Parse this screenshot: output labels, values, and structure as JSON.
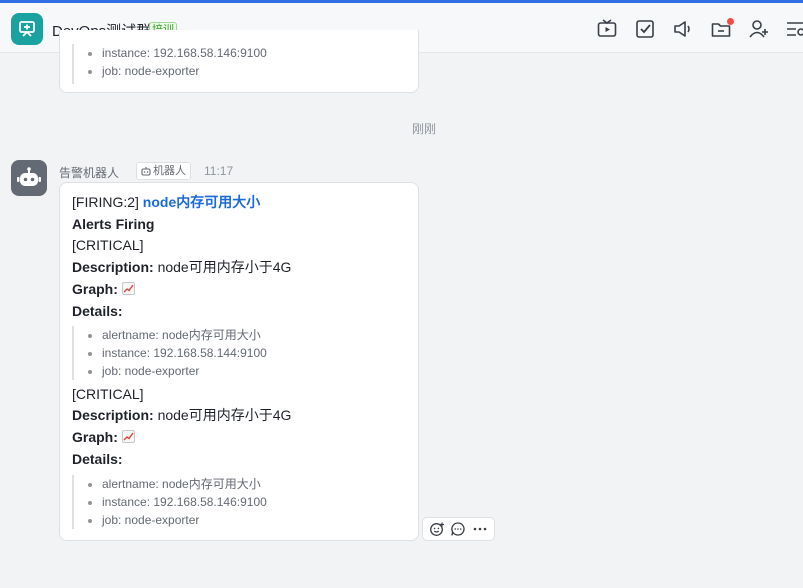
{
  "header": {
    "group_name": "DevOps测试群",
    "group_tag": "培训",
    "icons": [
      "tv-icon",
      "task-check-icon",
      "announcement-icon",
      "folder-icon",
      "add-member-icon",
      "more-menu-icon"
    ],
    "unread_dot_color": "#f54a45"
  },
  "previous_message": {
    "details": [
      "instance: 192.168.58.146:9100",
      "job: node-exporter"
    ]
  },
  "time_divider": "刚刚",
  "message": {
    "sender": "告警机器人",
    "badge": "机器人",
    "time": "11:17",
    "firing_prefix": "[FIRING:2]",
    "alert_title": "node内存可用大小",
    "heading": "Alerts Firing",
    "alerts": [
      {
        "severity": "[CRITICAL]",
        "description_label": "Description:",
        "description": "node可用内存小于4G",
        "graph_label": "Graph:",
        "details_label": "Details:",
        "details": [
          "alertname: node内存可用大小",
          "instance: 192.168.58.144:9100",
          "job: node-exporter"
        ]
      },
      {
        "severity": "[CRITICAL]",
        "description_label": "Description:",
        "description": "node可用内存小于4G",
        "graph_label": "Graph:",
        "details_label": "Details:",
        "details": [
          "alertname: node内存可用大小",
          "instance: 192.168.58.146:9100",
          "job: node-exporter"
        ]
      }
    ]
  },
  "actions": [
    "add-reaction-icon",
    "reply-icon",
    "more-icon"
  ],
  "colors": {
    "accent": "#2f6fe3",
    "link": "#1a6bd8",
    "group_avatar": "#1aa2a0",
    "bot_avatar": "#646a73"
  }
}
